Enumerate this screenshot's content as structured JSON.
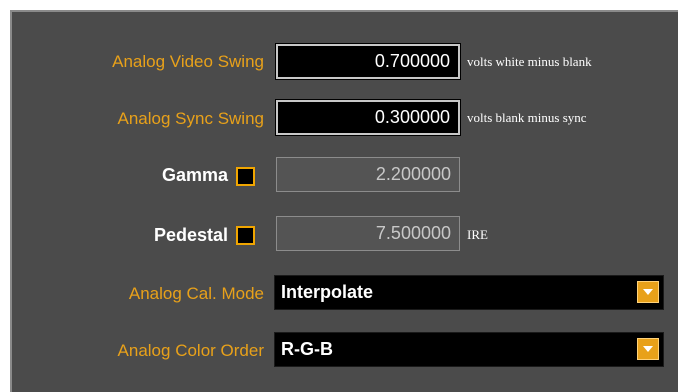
{
  "settings": {
    "analog_video_swing": {
      "label": "Analog Video Swing",
      "value": "0.700000",
      "unit": "volts white minus blank"
    },
    "analog_sync_swing": {
      "label": "Analog Sync Swing",
      "value": "0.300000",
      "unit": "volts blank minus sync"
    },
    "gamma": {
      "label": "Gamma",
      "value": "2.200000",
      "checked": false
    },
    "pedestal": {
      "label": "Pedestal",
      "value": "7.500000",
      "unit": "IRE",
      "checked": false
    },
    "analog_cal_mode": {
      "label": "Analog Cal. Mode",
      "selected": "Interpolate"
    },
    "analog_color_order": {
      "label": "Analog Color Order",
      "selected": "R-G-B"
    }
  },
  "colors": {
    "panel_bg": "#4b4b4b",
    "label_orange": "#e8a11a",
    "checkbox_border": "#f0a500"
  },
  "icons": {
    "dropdown": "chevron-down-icon"
  }
}
